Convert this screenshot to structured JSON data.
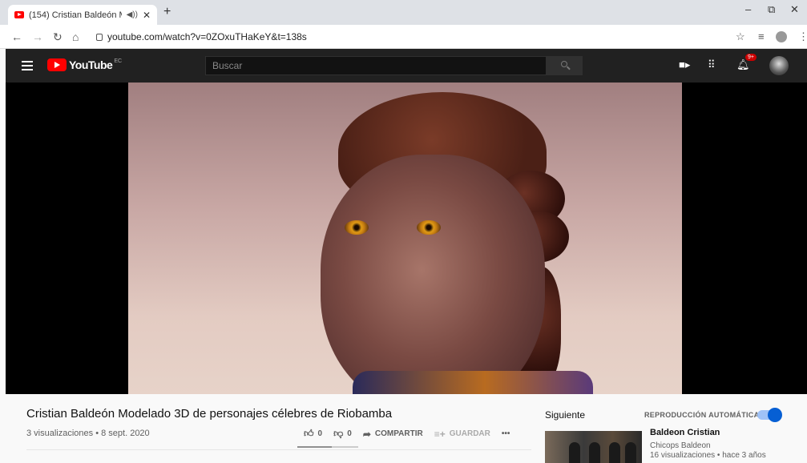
{
  "browser": {
    "tab_title": "(154) Cristian Baldeón Mode",
    "tab_audio_icon": "speaker-icon",
    "tab_close": "✕",
    "new_tab": "+",
    "url": "youtube.com/watch?v=0ZOxuTHaKeY&t=138s",
    "window_controls": {
      "minimize": "–",
      "restore": "⧉",
      "close": "✕"
    }
  },
  "youtube": {
    "logo_text": "YouTube",
    "country_code": "EC",
    "search_placeholder": "Buscar",
    "notifications_badge": "9+"
  },
  "video": {
    "title": "Cristian Baldeón Modelado 3D de personajes célebres de Riobamba",
    "meta": "3 visualizaciones • 8 sept. 2020",
    "likes": "0",
    "dislikes": "0",
    "share_label": "COMPARTIR",
    "save_label": "GUARDAR",
    "more_label": "•••"
  },
  "sidebar": {
    "up_next_label": "Siguiente",
    "autoplay_label": "REPRODUCCIÓN AUTOMÁTICA",
    "autoplay_on": true,
    "next_video": {
      "title": "Baldeon Cristian",
      "channel": "Chicops Baldeon",
      "meta": "16 visualizaciones • hace 3 años"
    }
  }
}
